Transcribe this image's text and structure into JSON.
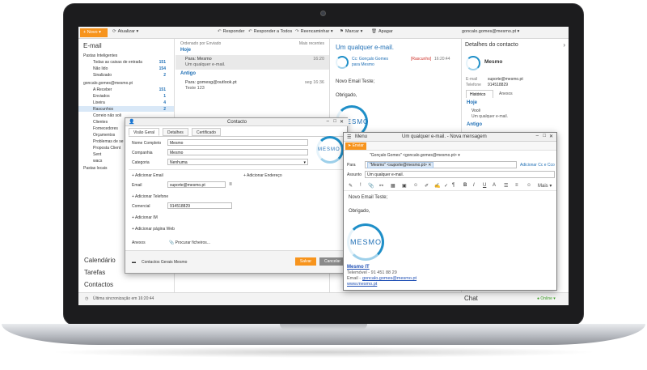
{
  "toolbar": {
    "new": "Novo",
    "refresh": "Atualizar",
    "reply": "Responder",
    "reply_all": "Responder a Todos",
    "forward": "Reencaminhar",
    "mark": "Marcar",
    "delete": "Apagar",
    "account": "goncalo.gomes@mesmo.pt"
  },
  "sidebar": {
    "title": "E-mail",
    "smart_folders": "Pastas Inteligentes",
    "items": [
      {
        "label": "Todas as caixas de entrada",
        "count": "151"
      },
      {
        "label": "Não lido",
        "count": "154"
      },
      {
        "label": "Sinalizado",
        "count": "2"
      }
    ],
    "account": "goncalo.gomes@mesmo.pt",
    "account_items": [
      {
        "label": "A Receber",
        "count": "151"
      },
      {
        "label": "Enviados",
        "count": "1"
      },
      {
        "label": "Lixeira",
        "count": "4"
      },
      {
        "label": "Rascunhos",
        "count": "2"
      },
      {
        "label": "Correio não soli",
        "count": ""
      },
      {
        "label": "Clientes",
        "count": ""
      },
      {
        "label": "Fornecedores",
        "count": ""
      },
      {
        "label": "Orçamentos",
        "count": ""
      },
      {
        "label": "Problemas de se",
        "count": ""
      },
      {
        "label": "Proposta Client",
        "count": ""
      },
      {
        "label": "Sent",
        "count": ""
      },
      {
        "label": "wacs",
        "count": ""
      }
    ],
    "local_folders": "Pastas locais",
    "nav": [
      "Calendário",
      "Tarefas",
      "Contactos"
    ],
    "sync_status": "Última sincronização em 16:20:44"
  },
  "list": {
    "sort": "Ordenado por Enviado",
    "sort_right": "Mais recentes",
    "group_today": "Hoje",
    "msg1_to": "Para: Mesmo",
    "msg1_subject": "Um qualquer e-mail.",
    "msg1_time": "16:20",
    "group_old": "Antigo",
    "msg2_to": "Para: gomesg@outlook.pt",
    "msg2_subject": "Teste 123",
    "msg2_date": "seg 16:36"
  },
  "reading": {
    "subject": "Um qualquer e-mail.",
    "from": "Cc: Gonçalo Gomes",
    "to": "para Mesmo",
    "draft": "[Rascunho]",
    "time": "16:20:44",
    "greeting": "Novo Email Teste;",
    "thanks": "Obrigado,"
  },
  "contact_panel": {
    "title": "Detalhes do contacto",
    "name": "Mesmo",
    "email_label": "E-mail",
    "email": "suporte@mesmo.pt",
    "phone_label": "Telefone",
    "phone": "914518829",
    "tab_history": "Histórico",
    "tab_attach": "Anexos",
    "group_today": "Hoje",
    "you": "Você",
    "you_text": "Um qualquer e-mail.",
    "group_old": "Antigo",
    "chat": "Chat",
    "online": "Online"
  },
  "contact_dialog": {
    "title": "Contacto",
    "tabs": [
      "Visão Geral",
      "Detalhes",
      "Certificado"
    ],
    "full_name_label": "Nome Completo",
    "full_name": "Mesmo",
    "company_label": "Companhia",
    "company": "Mesmo",
    "category_label": "Categoria",
    "category": "Nenhuma",
    "add_email": "Adicionar Email",
    "add_address": "Adicionar Endereço",
    "email_label": "Email",
    "email": "suporte@mesmo.pt",
    "add_phone": "Adicionar Telefone",
    "phone_label": "Comercial",
    "phone": "914518829",
    "add_im": "Adicionar IM",
    "add_web": "Adicionar página Web",
    "attachments": "Anexos",
    "browse": "Procurar ficheiros...",
    "folder": "Contactos Gerais Mesmo",
    "save": "Salvar",
    "cancel": "Cancelar"
  },
  "compose": {
    "menu": "Menu",
    "title": "Um qualquer e-mail. - Nova mensagem",
    "send": "Enviar",
    "from": "\"Gonçalo Gomes\" <goncalo.gomes@mesmo.pt>",
    "to_label": "Para",
    "to": "\"Mesmo\" <suporte@mesmo.pt>",
    "cc": "Adicionar Cc e Cco",
    "subject_label": "Assunto",
    "subject": "Um qualquer e-mail.",
    "more": "Mais",
    "body_line1": "Novo Email Teste;",
    "body_line2": "Obrigado,",
    "logo_text": "MESMO",
    "sig_name": "Mesmo IT",
    "sig_phone": "Telemóvel - 91 451 88 29",
    "sig_email_label": "Email -",
    "sig_email": "goncalo.gomes@mesmo.pt",
    "sig_site": "www.mesmo.pt"
  },
  "logo_text": "MESMO",
  "colors": {
    "accent": "#f7941d",
    "link": "#1f6fb5",
    "draft": "#d0342c"
  }
}
